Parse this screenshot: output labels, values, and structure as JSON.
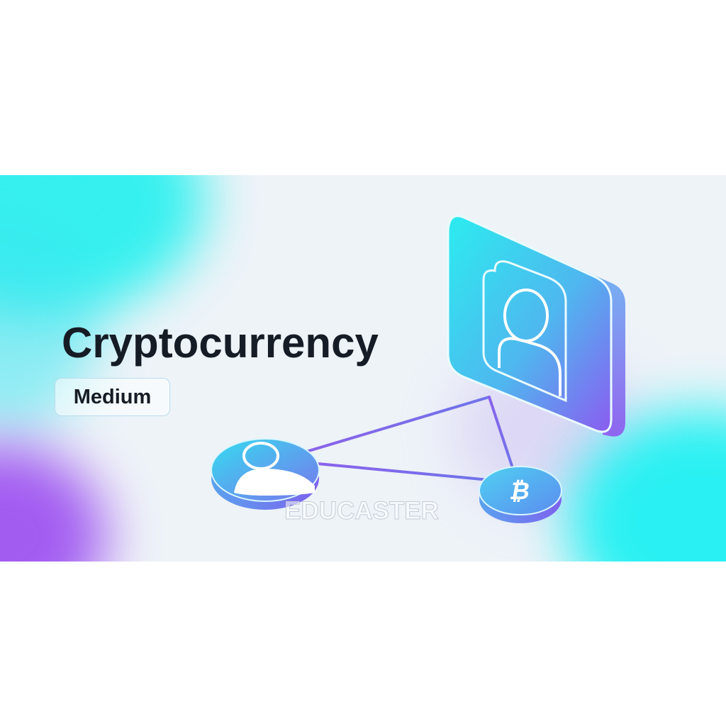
{
  "title": "Cryptocurrency",
  "difficulty_badge": "Medium",
  "watermark": "EDUCASTER",
  "illustration": {
    "large_card_icon": "user-profile-icon",
    "small_node_icon": "user-icon",
    "coin_icon": "bitcoin-icon"
  },
  "colors": {
    "accent_cyan": "#22f0ee",
    "accent_purple": "#9a4cf0",
    "banner_background": "#eef3f8",
    "text_dark": "#161c25"
  }
}
